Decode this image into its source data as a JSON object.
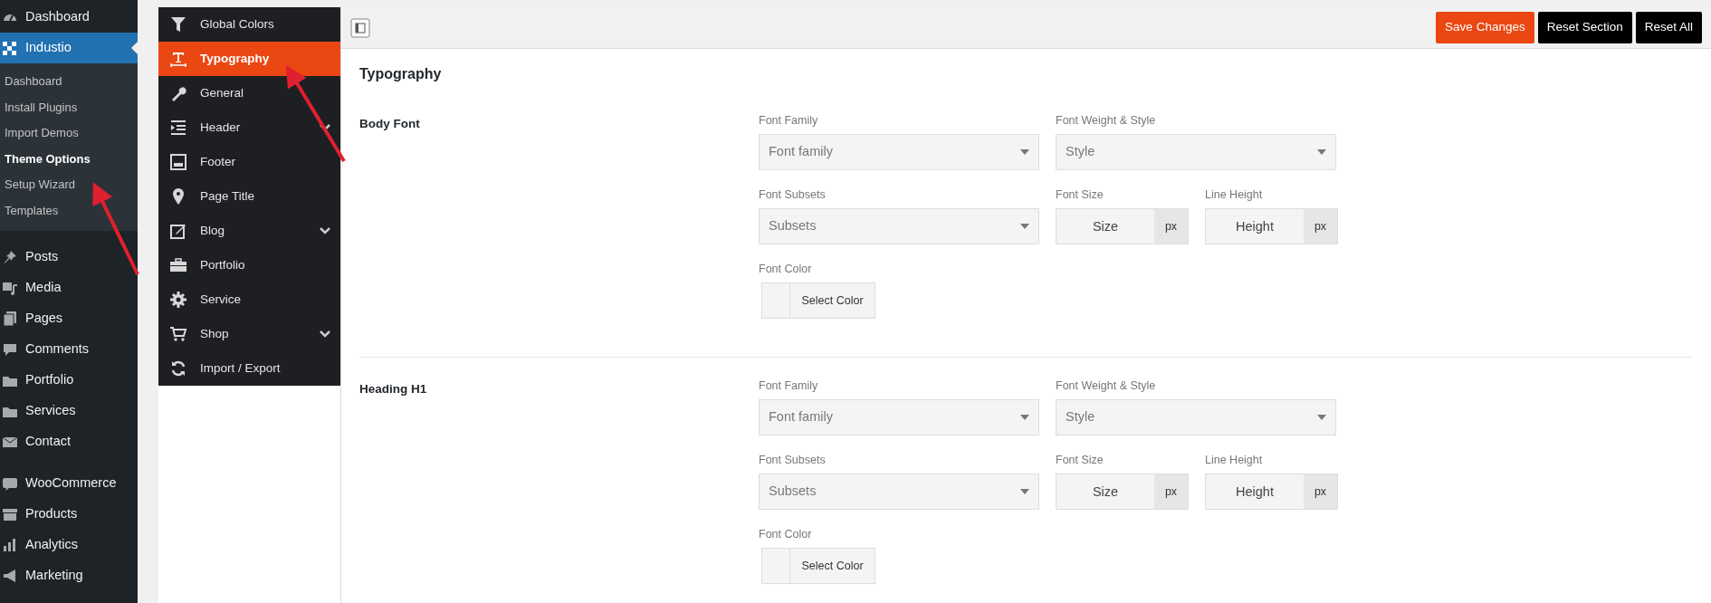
{
  "admin_menu": [
    {
      "label": "Dashboard",
      "selected": false
    },
    {
      "label": "Industio",
      "selected": true,
      "children": [
        {
          "label": "Dashboard",
          "selected": false
        },
        {
          "label": "Install Plugins",
          "selected": false
        },
        {
          "label": "Import Demos",
          "selected": false
        },
        {
          "label": "Theme Options",
          "selected": true
        },
        {
          "label": "Setup Wizard",
          "selected": false
        },
        {
          "label": "Templates",
          "selected": false
        }
      ]
    },
    {
      "label": "Posts",
      "selected": false
    },
    {
      "label": "Media",
      "selected": false
    },
    {
      "label": "Pages",
      "selected": false
    },
    {
      "label": "Comments",
      "selected": false
    },
    {
      "label": "Portfolio",
      "selected": false
    },
    {
      "label": "Services",
      "selected": false
    },
    {
      "label": "Contact",
      "selected": false
    },
    {
      "label": "WooCommerce",
      "selected": false
    },
    {
      "label": "Products",
      "selected": false
    },
    {
      "label": "Analytics",
      "selected": false
    },
    {
      "label": "Marketing",
      "selected": false
    }
  ],
  "options_nav": [
    {
      "label": "Global Colors",
      "selected": false,
      "expandable": false
    },
    {
      "label": "Typography",
      "selected": true,
      "expandable": false
    },
    {
      "label": "General",
      "selected": false,
      "expandable": false
    },
    {
      "label": "Header",
      "selected": false,
      "expandable": true
    },
    {
      "label": "Footer",
      "selected": false,
      "expandable": false
    },
    {
      "label": "Page Title",
      "selected": false,
      "expandable": false
    },
    {
      "label": "Blog",
      "selected": false,
      "expandable": true
    },
    {
      "label": "Portfolio",
      "selected": false,
      "expandable": false
    },
    {
      "label": "Service",
      "selected": false,
      "expandable": false
    },
    {
      "label": "Shop",
      "selected": false,
      "expandable": true
    },
    {
      "label": "Import / Export",
      "selected": false,
      "expandable": false
    }
  ],
  "toolbar": {
    "buttons": [
      {
        "label": "Save Changes",
        "kind": "primary"
      },
      {
        "label": "Reset Section",
        "kind": "dark"
      },
      {
        "label": "Reset All",
        "kind": "dark"
      }
    ]
  },
  "page_title": "Typography",
  "sections": [
    {
      "title": "Body Font",
      "rows": [
        [
          {
            "kind": "select",
            "label": "Font Family",
            "placeholder": "Font family"
          },
          {
            "kind": "select",
            "label": "Font Weight & Style",
            "placeholder": "Style"
          }
        ],
        [
          {
            "kind": "select",
            "label": "Font Subsets",
            "placeholder": "Subsets"
          },
          {
            "kind": "unit",
            "label": "Font Size",
            "placeholder": "Size",
            "unit": "px"
          },
          {
            "kind": "unit",
            "label": "Line Height",
            "placeholder": "Height",
            "unit": "px"
          }
        ],
        [
          {
            "kind": "color",
            "label": "Font Color",
            "button": "Select Color"
          }
        ]
      ]
    },
    {
      "title": "Heading H1",
      "rows": [
        [
          {
            "kind": "select",
            "label": "Font Family",
            "placeholder": "Font family"
          },
          {
            "kind": "select",
            "label": "Font Weight & Style",
            "placeholder": "Style"
          }
        ],
        [
          {
            "kind": "select",
            "label": "Font Subsets",
            "placeholder": "Subsets"
          },
          {
            "kind": "unit",
            "label": "Font Size",
            "placeholder": "Size",
            "unit": "px"
          },
          {
            "kind": "unit",
            "label": "Line Height",
            "placeholder": "Height",
            "unit": "px"
          }
        ],
        [
          {
            "kind": "color",
            "label": "Font Color",
            "button": "Select Color"
          }
        ]
      ]
    }
  ]
}
